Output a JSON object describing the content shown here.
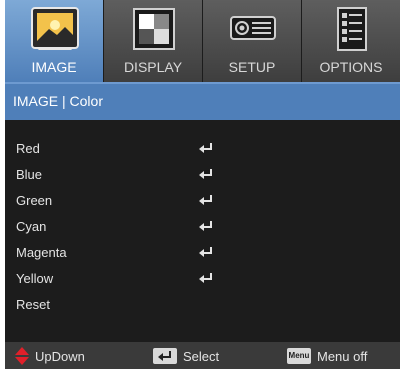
{
  "tabs": [
    {
      "label": "IMAGE",
      "icon": "image-icon"
    },
    {
      "label": "DISPLAY",
      "icon": "display-icon"
    },
    {
      "label": "SETUP",
      "icon": "projector-icon"
    },
    {
      "label": "OPTIONS",
      "icon": "options-icon"
    }
  ],
  "header": {
    "title": "IMAGE | Color"
  },
  "menu": {
    "items": [
      {
        "label": "Red",
        "icon": "enter-icon"
      },
      {
        "label": "Blue",
        "icon": "enter-icon"
      },
      {
        "label": "Green",
        "icon": "enter-icon"
      },
      {
        "label": "Cyan",
        "icon": "enter-icon"
      },
      {
        "label": "Magenta",
        "icon": "enter-icon"
      },
      {
        "label": "Yellow",
        "icon": "enter-icon"
      },
      {
        "label": "Reset"
      }
    ]
  },
  "footer": {
    "updown_label": "UpDown",
    "select_label": "Select",
    "menu_key": "Menu",
    "menu_label": "Menu off"
  },
  "colors": {
    "accent": "#4f7fb9",
    "background": "#1c1c1c",
    "updown_arrow": "#e0202a"
  }
}
